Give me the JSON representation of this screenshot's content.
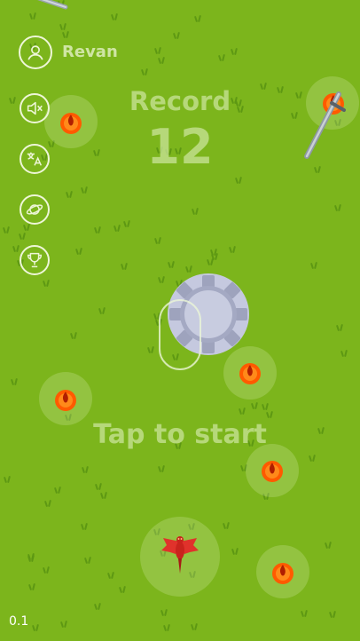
{
  "user": {
    "name": "Revan",
    "avatar_icon": "user-avatar-icon"
  },
  "menu": [
    {
      "id": "sound",
      "icon": "sound-muted-icon"
    },
    {
      "id": "language",
      "icon": "translate-icon"
    },
    {
      "id": "world",
      "icon": "planet-icon"
    },
    {
      "id": "trophy",
      "icon": "trophy-icon"
    }
  ],
  "record": {
    "label": "Record",
    "value": "12"
  },
  "prompt": "Tap to start",
  "version": "0.1",
  "colors": {
    "grass": "#7cb51c",
    "grass_tuft": "#5d9813",
    "text_faded": "#cde6a0",
    "fire": "#ff6a00"
  },
  "sprites": [
    "sword-icon",
    "gear-coin-icon",
    "shield-outline-icon",
    "dragon-icon",
    "fireball-icon"
  ]
}
